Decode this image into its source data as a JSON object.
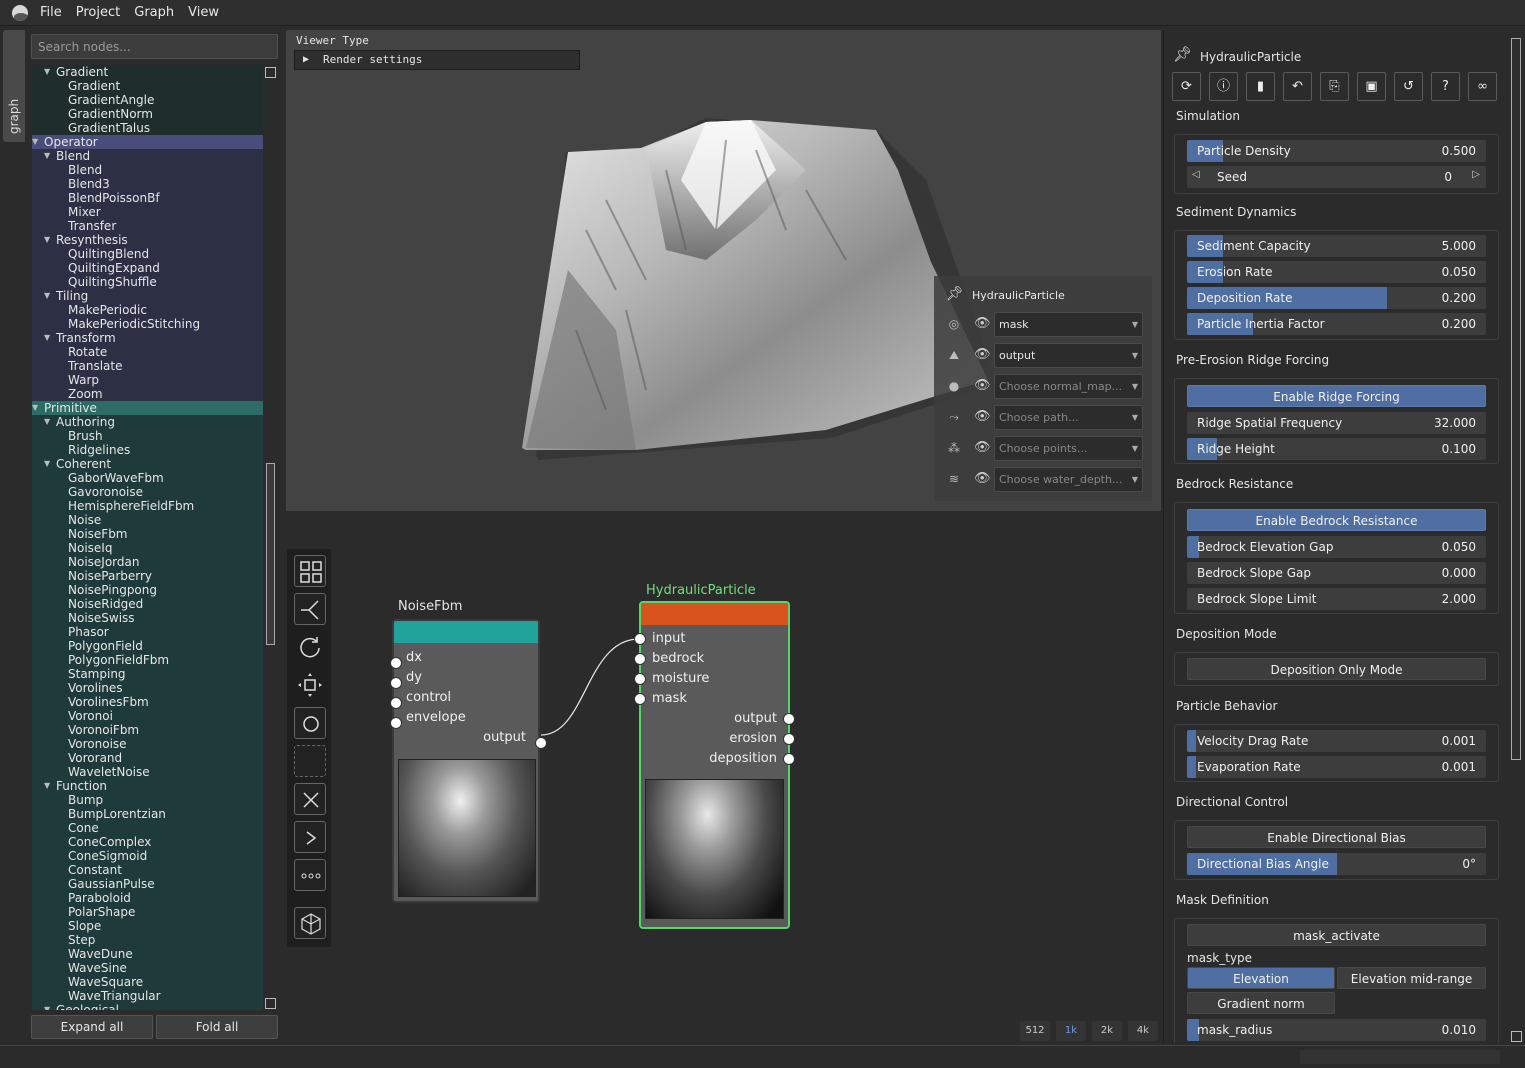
{
  "menu": {
    "items": [
      "File",
      "Project",
      "Graph",
      "View"
    ]
  },
  "side_tab": {
    "label": "graph"
  },
  "library": {
    "search_placeholder": "Search nodes...",
    "tree": [
      {
        "label": "Gradient",
        "level": 1,
        "kind": "folder",
        "group": "grad"
      },
      {
        "label": "Gradient",
        "level": 2,
        "kind": "leaf",
        "group": "grad"
      },
      {
        "label": "GradientAngle",
        "level": 2,
        "kind": "leaf",
        "group": "grad"
      },
      {
        "label": "GradientNorm",
        "level": 2,
        "kind": "leaf",
        "group": "grad"
      },
      {
        "label": "GradientTalus",
        "level": 2,
        "kind": "leaf",
        "group": "grad"
      },
      {
        "label": "Operator",
        "level": 0,
        "kind": "category",
        "group": "op"
      },
      {
        "label": "Blend",
        "level": 1,
        "kind": "folder",
        "group": "op"
      },
      {
        "label": "Blend",
        "level": 2,
        "kind": "leaf",
        "group": "op"
      },
      {
        "label": "Blend3",
        "level": 2,
        "kind": "leaf",
        "group": "op"
      },
      {
        "label": "BlendPoissonBf",
        "level": 2,
        "kind": "leaf",
        "group": "op"
      },
      {
        "label": "Mixer",
        "level": 2,
        "kind": "leaf",
        "group": "op"
      },
      {
        "label": "Transfer",
        "level": 2,
        "kind": "leaf",
        "group": "op"
      },
      {
        "label": "Resynthesis",
        "level": 1,
        "kind": "folder",
        "group": "op"
      },
      {
        "label": "QuiltingBlend",
        "level": 2,
        "kind": "leaf",
        "group": "op"
      },
      {
        "label": "QuiltingExpand",
        "level": 2,
        "kind": "leaf",
        "group": "op"
      },
      {
        "label": "QuiltingShuffle",
        "level": 2,
        "kind": "leaf",
        "group": "op"
      },
      {
        "label": "Tiling",
        "level": 1,
        "kind": "folder",
        "group": "op"
      },
      {
        "label": "MakePeriodic",
        "level": 2,
        "kind": "leaf",
        "group": "op"
      },
      {
        "label": "MakePeriodicStitching",
        "level": 2,
        "kind": "leaf",
        "group": "op"
      },
      {
        "label": "Transform",
        "level": 1,
        "kind": "folder",
        "group": "op"
      },
      {
        "label": "Rotate",
        "level": 2,
        "kind": "leaf",
        "group": "op"
      },
      {
        "label": "Translate",
        "level": 2,
        "kind": "leaf",
        "group": "op"
      },
      {
        "label": "Warp",
        "level": 2,
        "kind": "leaf",
        "group": "op"
      },
      {
        "label": "Zoom",
        "level": 2,
        "kind": "leaf",
        "group": "op"
      },
      {
        "label": "Primitive",
        "level": 0,
        "kind": "category2",
        "group": "prim"
      },
      {
        "label": "Authoring",
        "level": 1,
        "kind": "folder",
        "group": "prim"
      },
      {
        "label": "Brush",
        "level": 2,
        "kind": "leaf",
        "group": "prim"
      },
      {
        "label": "Ridgelines",
        "level": 2,
        "kind": "leaf",
        "group": "prim"
      },
      {
        "label": "Coherent",
        "level": 1,
        "kind": "folder",
        "group": "prim"
      },
      {
        "label": "GaborWaveFbm",
        "level": 2,
        "kind": "leaf",
        "group": "prim"
      },
      {
        "label": "Gavoronoise",
        "level": 2,
        "kind": "leaf",
        "group": "prim"
      },
      {
        "label": "HemisphereFieldFbm",
        "level": 2,
        "kind": "leaf",
        "group": "prim"
      },
      {
        "label": "Noise",
        "level": 2,
        "kind": "leaf",
        "group": "prim"
      },
      {
        "label": "NoiseFbm",
        "level": 2,
        "kind": "leaf",
        "group": "prim"
      },
      {
        "label": "NoiseIq",
        "level": 2,
        "kind": "leaf",
        "group": "prim"
      },
      {
        "label": "NoiseJordan",
        "level": 2,
        "kind": "leaf",
        "group": "prim"
      },
      {
        "label": "NoiseParberry",
        "level": 2,
        "kind": "leaf",
        "group": "prim"
      },
      {
        "label": "NoisePingpong",
        "level": 2,
        "kind": "leaf",
        "group": "prim"
      },
      {
        "label": "NoiseRidged",
        "level": 2,
        "kind": "leaf",
        "group": "prim"
      },
      {
        "label": "NoiseSwiss",
        "level": 2,
        "kind": "leaf",
        "group": "prim"
      },
      {
        "label": "Phasor",
        "level": 2,
        "kind": "leaf",
        "group": "prim"
      },
      {
        "label": "PolygonField",
        "level": 2,
        "kind": "leaf",
        "group": "prim"
      },
      {
        "label": "PolygonFieldFbm",
        "level": 2,
        "kind": "leaf",
        "group": "prim"
      },
      {
        "label": "Stamping",
        "level": 2,
        "kind": "leaf",
        "group": "prim"
      },
      {
        "label": "Vorolines",
        "level": 2,
        "kind": "leaf",
        "group": "prim"
      },
      {
        "label": "VorolinesFbm",
        "level": 2,
        "kind": "leaf",
        "group": "prim"
      },
      {
        "label": "Voronoi",
        "level": 2,
        "kind": "leaf",
        "group": "prim"
      },
      {
        "label": "VoronoiFbm",
        "level": 2,
        "kind": "leaf",
        "group": "prim"
      },
      {
        "label": "Voronoise",
        "level": 2,
        "kind": "leaf",
        "group": "prim"
      },
      {
        "label": "Vororand",
        "level": 2,
        "kind": "leaf",
        "group": "prim"
      },
      {
        "label": "WaveletNoise",
        "level": 2,
        "kind": "leaf",
        "group": "prim"
      },
      {
        "label": "Function",
        "level": 1,
        "kind": "folder",
        "group": "prim"
      },
      {
        "label": "Bump",
        "level": 2,
        "kind": "leaf",
        "group": "prim"
      },
      {
        "label": "BumpLorentzian",
        "level": 2,
        "kind": "leaf",
        "group": "prim"
      },
      {
        "label": "Cone",
        "level": 2,
        "kind": "leaf",
        "group": "prim"
      },
      {
        "label": "ConeComplex",
        "level": 2,
        "kind": "leaf",
        "group": "prim"
      },
      {
        "label": "ConeSigmoid",
        "level": 2,
        "kind": "leaf",
        "group": "prim"
      },
      {
        "label": "Constant",
        "level": 2,
        "kind": "leaf",
        "group": "prim"
      },
      {
        "label": "GaussianPulse",
        "level": 2,
        "kind": "leaf",
        "group": "prim"
      },
      {
        "label": "Paraboloid",
        "level": 2,
        "kind": "leaf",
        "group": "prim"
      },
      {
        "label": "PolarShape",
        "level": 2,
        "kind": "leaf",
        "group": "prim"
      },
      {
        "label": "Slope",
        "level": 2,
        "kind": "leaf",
        "group": "prim"
      },
      {
        "label": "Step",
        "level": 2,
        "kind": "leaf",
        "group": "prim"
      },
      {
        "label": "WaveDune",
        "level": 2,
        "kind": "leaf",
        "group": "prim"
      },
      {
        "label": "WaveSine",
        "level": 2,
        "kind": "leaf",
        "group": "prim"
      },
      {
        "label": "WaveSquare",
        "level": 2,
        "kind": "leaf",
        "group": "prim"
      },
      {
        "label": "WaveTriangular",
        "level": 2,
        "kind": "leaf",
        "group": "prim"
      },
      {
        "label": "Geological",
        "level": 1,
        "kind": "folder",
        "group": "prim"
      }
    ],
    "expand_all_label": "Expand all",
    "fold_all_label": "Fold all"
  },
  "viewer": {
    "viewer_type_label": "Viewer Type",
    "render_settings_label": "Render settings",
    "overlay": {
      "title": "HydraulicParticle",
      "rows": [
        {
          "icon": "terrain-icon",
          "value": "mask",
          "placeholder": false
        },
        {
          "icon": "mountain-icon",
          "value": "output",
          "placeholder": false
        },
        {
          "icon": "normal-map-icon",
          "value": "Choose normal_map...",
          "placeholder": true
        },
        {
          "icon": "path-icon",
          "value": "Choose path...",
          "placeholder": true
        },
        {
          "icon": "points-icon",
          "value": "Choose points...",
          "placeholder": true
        },
        {
          "icon": "water-icon",
          "value": "Choose water_depth...",
          "placeholder": true
        }
      ]
    }
  },
  "graph": {
    "nodes": {
      "noisefbm": {
        "title": "NoiseFbm",
        "header_color": "#1fa39b",
        "inputs": [
          "dx",
          "dy",
          "control",
          "envelope"
        ],
        "outputs": [
          "output"
        ]
      },
      "hydraulic": {
        "title": "HydraulicParticle",
        "header_color": "#d9541c",
        "inputs": [
          "input",
          "bedrock",
          "moisture",
          "mask"
        ],
        "outputs": [
          "output",
          "erosion",
          "deposition"
        ]
      }
    },
    "resolutions": [
      {
        "label": "512",
        "active": false
      },
      {
        "label": "1k",
        "active": true
      },
      {
        "label": "2k",
        "active": false
      },
      {
        "label": "4k",
        "active": false
      }
    ]
  },
  "props": {
    "title": "HydraulicParticle",
    "sections": {
      "simulation": {
        "title": "Simulation",
        "particle_density": {
          "label": "Particle Density",
          "value": "0.500",
          "fraction": 0.12
        },
        "seed": {
          "label": "Seed",
          "value": "0"
        }
      },
      "sediment": {
        "title": "Sediment Dynamics",
        "sediment_capacity": {
          "label": "Sediment Capacity",
          "value": "5.000",
          "fraction": 0.12
        },
        "erosion_rate": {
          "label": "Erosion Rate",
          "value": "0.050",
          "fraction": 0.12
        },
        "deposition_rate": {
          "label": "Deposition Rate",
          "value": "0.200",
          "fraction": 0.67
        },
        "inertia": {
          "label": "Particle Inertia Factor",
          "value": "0.200",
          "fraction": 0.22
        }
      },
      "ridge": {
        "title": "Pre-Erosion Ridge Forcing",
        "enable": "Enable Ridge Forcing",
        "frequency": {
          "label": "Ridge Spatial Frequency",
          "value": "32.000",
          "fraction": 0.0
        },
        "height": {
          "label": "Ridge Height",
          "value": "0.100",
          "fraction": 0.1
        }
      },
      "bedrock": {
        "title": "Bedrock Resistance",
        "enable": "Enable Bedrock Resistance",
        "elevation_gap": {
          "label": "Bedrock Elevation Gap",
          "value": "0.050",
          "fraction": 0.04
        },
        "slope_gap": {
          "label": "Bedrock Slope Gap",
          "value": "0.000",
          "fraction": 0.0
        },
        "slope_limit": {
          "label": "Bedrock Slope Limit",
          "value": "2.000",
          "fraction": 0.0
        }
      },
      "deposition_mode": {
        "title": "Deposition Mode",
        "button": "Deposition Only Mode"
      },
      "behavior": {
        "title": "Particle Behavior",
        "drag": {
          "label": "Velocity Drag Rate",
          "value": "0.001",
          "fraction": 0.03
        },
        "evaporation": {
          "label": "Evaporation Rate",
          "value": "0.001",
          "fraction": 0.03
        }
      },
      "directional": {
        "title": "Directional Control",
        "enable": "Enable Directional Bias",
        "angle": {
          "label": "Directional Bias Angle",
          "value": "0°",
          "fraction": 0.5
        }
      },
      "mask": {
        "title": "Mask Definition",
        "activate": "mask_activate",
        "type_label": "mask_type",
        "type_options": [
          "Elevation",
          "Elevation mid-range",
          "Gradient norm"
        ],
        "radius": {
          "label": "mask_radius",
          "value": "0.010",
          "fraction": 0.04
        }
      }
    }
  }
}
